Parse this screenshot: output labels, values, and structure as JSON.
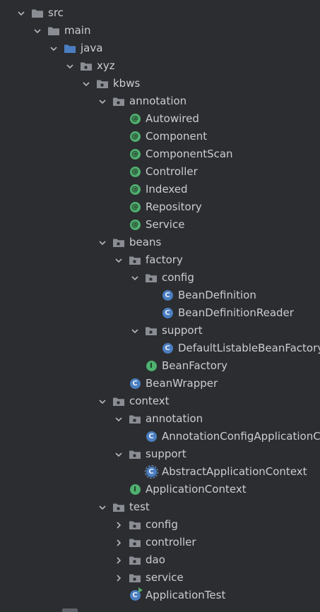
{
  "colors": {
    "background": "#2b2d30",
    "text": "#cbcdd2",
    "folder": "#8a8d93",
    "source_root_folder": "#4b7ec1",
    "annotation_badge": "#4fb06f",
    "class_badge": "#4b7ec1",
    "interface_badge": "#4fb06f"
  },
  "tree": [
    {
      "label": "src",
      "depth": 0,
      "expand": "open",
      "icon": "folder-icon"
    },
    {
      "label": "main",
      "depth": 1,
      "expand": "open",
      "icon": "folder-icon"
    },
    {
      "label": "java",
      "depth": 2,
      "expand": "open",
      "icon": "source-folder-icon"
    },
    {
      "label": "xyz",
      "depth": 3,
      "expand": "open",
      "icon": "package-icon"
    },
    {
      "label": "kbws",
      "depth": 4,
      "expand": "open",
      "icon": "package-icon"
    },
    {
      "label": "annotation",
      "depth": 5,
      "expand": "open",
      "icon": "package-icon"
    },
    {
      "label": "Autowired",
      "depth": 6,
      "expand": "none",
      "icon": "annotation-icon"
    },
    {
      "label": "Component",
      "depth": 6,
      "expand": "none",
      "icon": "annotation-icon"
    },
    {
      "label": "ComponentScan",
      "depth": 6,
      "expand": "none",
      "icon": "annotation-icon"
    },
    {
      "label": "Controller",
      "depth": 6,
      "expand": "none",
      "icon": "annotation-icon"
    },
    {
      "label": "Indexed",
      "depth": 6,
      "expand": "none",
      "icon": "annotation-icon"
    },
    {
      "label": "Repository",
      "depth": 6,
      "expand": "none",
      "icon": "annotation-icon"
    },
    {
      "label": "Service",
      "depth": 6,
      "expand": "none",
      "icon": "annotation-icon"
    },
    {
      "label": "beans",
      "depth": 5,
      "expand": "open",
      "icon": "package-icon"
    },
    {
      "label": "factory",
      "depth": 6,
      "expand": "open",
      "icon": "package-icon"
    },
    {
      "label": "config",
      "depth": 7,
      "expand": "open",
      "icon": "package-icon"
    },
    {
      "label": "BeanDefinition",
      "depth": 8,
      "expand": "none",
      "icon": "class-icon"
    },
    {
      "label": "BeanDefinitionReader",
      "depth": 8,
      "expand": "none",
      "icon": "class-icon"
    },
    {
      "label": "support",
      "depth": 7,
      "expand": "open",
      "icon": "package-icon"
    },
    {
      "label": "DefaultListableBeanFactory",
      "depth": 8,
      "expand": "none",
      "icon": "class-icon"
    },
    {
      "label": "BeanFactory",
      "depth": 7,
      "expand": "none",
      "icon": "interface-icon"
    },
    {
      "label": "BeanWrapper",
      "depth": 6,
      "expand": "none",
      "icon": "class-icon"
    },
    {
      "label": "context",
      "depth": 5,
      "expand": "open",
      "icon": "package-icon"
    },
    {
      "label": "annotation",
      "depth": 6,
      "expand": "open",
      "icon": "package-icon"
    },
    {
      "label": "AnnotationConfigApplicationContext",
      "depth": 7,
      "expand": "none",
      "icon": "class-icon"
    },
    {
      "label": "support",
      "depth": 6,
      "expand": "open",
      "icon": "package-icon"
    },
    {
      "label": "AbstractApplicationContext",
      "depth": 7,
      "expand": "none",
      "icon": "abstract-class-icon"
    },
    {
      "label": "ApplicationContext",
      "depth": 6,
      "expand": "none",
      "icon": "interface-icon"
    },
    {
      "label": "test",
      "depth": 5,
      "expand": "open",
      "icon": "package-icon"
    },
    {
      "label": "config",
      "depth": 6,
      "expand": "closed",
      "icon": "package-icon"
    },
    {
      "label": "controller",
      "depth": 6,
      "expand": "closed",
      "icon": "package-icon"
    },
    {
      "label": "dao",
      "depth": 6,
      "expand": "closed",
      "icon": "package-icon"
    },
    {
      "label": "service",
      "depth": 6,
      "expand": "closed",
      "icon": "package-icon"
    },
    {
      "label": "ApplicationTest",
      "depth": 6,
      "expand": "none",
      "icon": "runnable-class-icon"
    }
  ]
}
